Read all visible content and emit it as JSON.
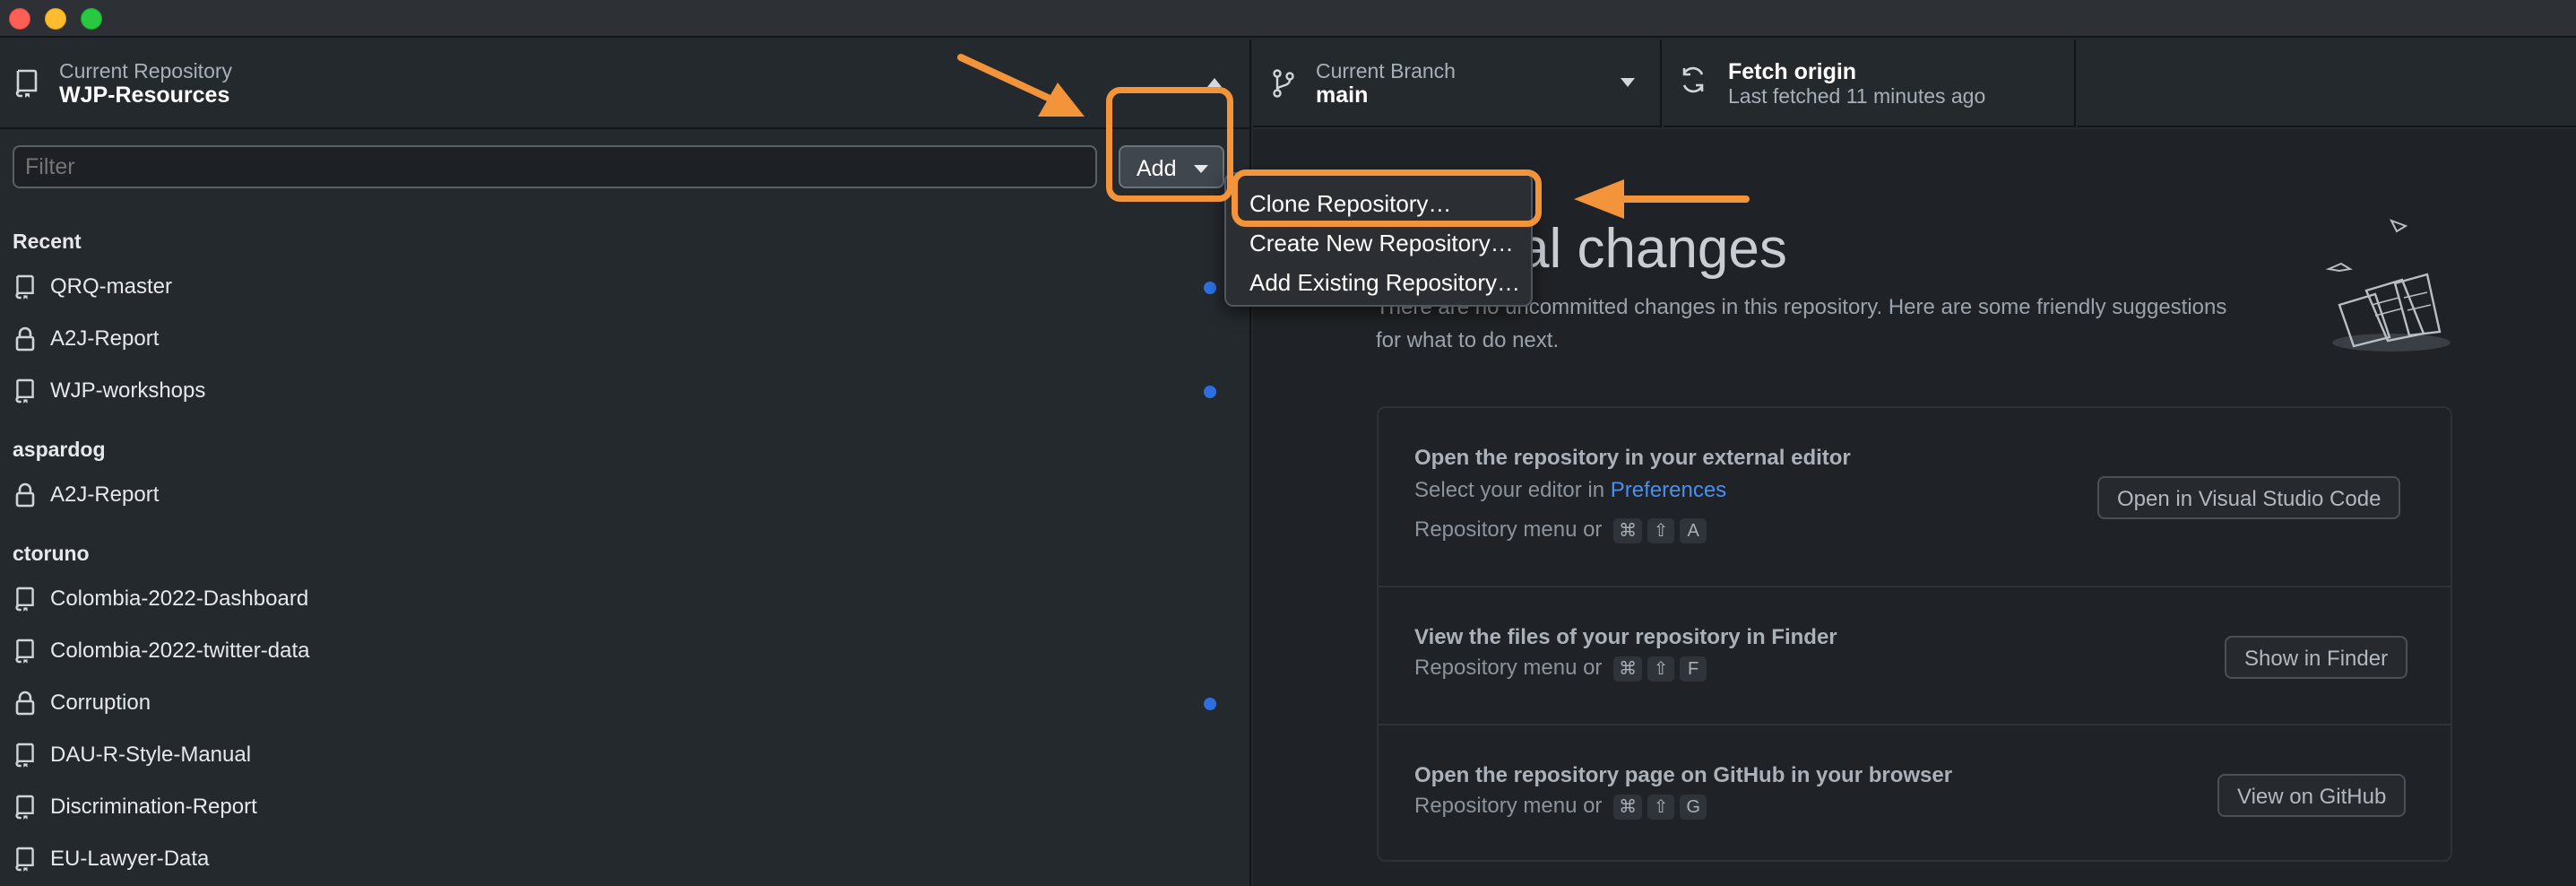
{
  "window": {
    "traffic_lights": [
      "close",
      "minimize",
      "zoom"
    ]
  },
  "sidebar": {
    "header": {
      "caption": "Current Repository",
      "value": "WJP-Resources"
    },
    "filter_placeholder": "Filter",
    "add_label": "Add",
    "sections": [
      {
        "title": "Recent",
        "items": [
          {
            "name": "QRQ-master",
            "icon": "repo-icon",
            "dot": true
          },
          {
            "name": "A2J-Report",
            "icon": "lock-icon",
            "dot": false
          },
          {
            "name": "WJP-workshops",
            "icon": "repo-icon",
            "dot": true
          }
        ]
      },
      {
        "title": "aspardog",
        "items": [
          {
            "name": "A2J-Report",
            "icon": "lock-icon",
            "dot": false
          }
        ]
      },
      {
        "title": "ctoruno",
        "items": [
          {
            "name": "Colombia-2022-Dashboard",
            "icon": "repo-icon",
            "dot": false
          },
          {
            "name": "Colombia-2022-twitter-data",
            "icon": "repo-icon",
            "dot": false
          },
          {
            "name": "Corruption",
            "icon": "lock-icon",
            "dot": true
          },
          {
            "name": "DAU-R-Style-Manual",
            "icon": "repo-icon",
            "dot": false
          },
          {
            "name": "Discrimination-Report",
            "icon": "repo-icon",
            "dot": false
          },
          {
            "name": "EU-Lawyer-Data",
            "icon": "repo-icon",
            "dot": false
          }
        ]
      }
    ]
  },
  "toolbar": {
    "branch": {
      "caption": "Current Branch",
      "value": "main"
    },
    "fetch": {
      "title": "Fetch origin",
      "subtitle": "Last fetched 11 minutes ago"
    }
  },
  "menu": {
    "items": [
      "Clone Repository…",
      "Create New Repository…",
      "Add Existing Repository…"
    ]
  },
  "main": {
    "heading_visible": "al changes",
    "description_line1": "There are no uncommitted changes in this repository. Here are some friendly suggestions",
    "description_line2": "for what to do next.",
    "suggestions": [
      {
        "title": "Open the repository in your external editor",
        "subtitle_prefix": "Select your editor in ",
        "subtitle_link": "Preferences",
        "shortcut_label": "Repository menu or",
        "keys": [
          "⌘",
          "⇧",
          "A"
        ],
        "button": "Open in Visual Studio Code"
      },
      {
        "title": "View the files of your repository in Finder",
        "shortcut_label": "Repository menu or",
        "keys": [
          "⌘",
          "⇧",
          "F"
        ],
        "button": "Show in Finder"
      },
      {
        "title": "Open the repository page on GitHub in your browser",
        "shortcut_label": "Repository menu or",
        "keys": [
          "⌘",
          "⇧",
          "G"
        ],
        "button": "View on GitHub"
      }
    ]
  },
  "colors": {
    "highlight": "#f3943a",
    "accent_dot": "#2d6fe0",
    "link": "#4a8ff0"
  }
}
